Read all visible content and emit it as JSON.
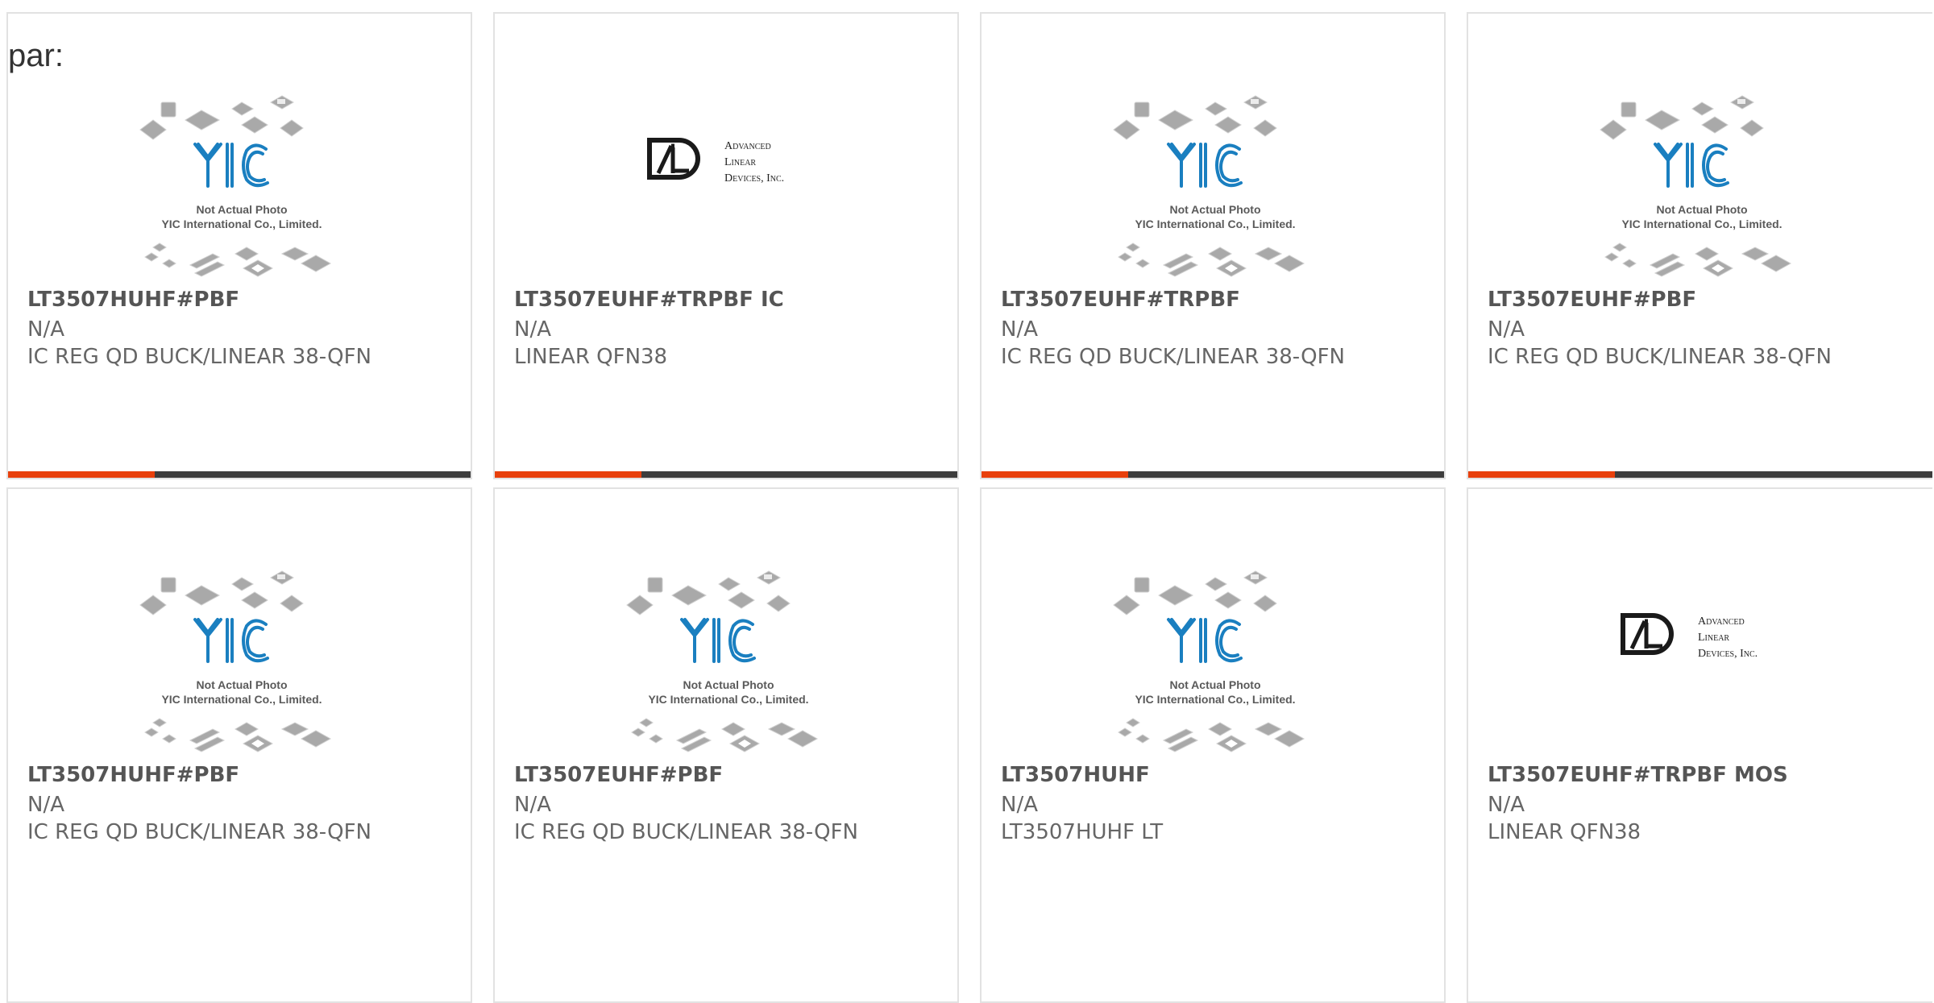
{
  "header": {
    "label": "par:"
  },
  "colors": {
    "accent": "#e8400c",
    "bar": "#3d3d3d",
    "logo_blue": "#1a7fc0"
  },
  "image_texts": {
    "yic_line1": "Not Actual Photo",
    "yic_line2": "YIC International Co., Limited.",
    "ald_line1": "Advanced",
    "ald_line2": "Linear",
    "ald_line3": "Devices, Inc."
  },
  "products": [
    {
      "image": "yic-placeholder",
      "part": "LT3507HUHF#PBF",
      "mfr": "N/A",
      "desc": "IC REG QD BUCK/LINEAR 38-QFN"
    },
    {
      "image": "ald-logo",
      "part": "LT3507EUHF#TRPBF IC",
      "mfr": "N/A",
      "desc": "LINEAR QFN38"
    },
    {
      "image": "yic-placeholder",
      "part": "LT3507EUHF#TRPBF",
      "mfr": "N/A",
      "desc": "IC REG QD BUCK/LINEAR 38-QFN"
    },
    {
      "image": "yic-placeholder",
      "part": "LT3507EUHF#PBF",
      "mfr": "N/A",
      "desc": "IC REG QD BUCK/LINEAR 38-QFN"
    },
    {
      "image": "yic-placeholder",
      "part": "LT3507HUHF#PBF",
      "mfr": "N/A",
      "desc": "IC REG QD BUCK/LINEAR 38-QFN"
    },
    {
      "image": "yic-placeholder",
      "part": "LT3507EUHF#PBF",
      "mfr": "N/A",
      "desc": "IC REG QD BUCK/LINEAR 38-QFN"
    },
    {
      "image": "yic-placeholder",
      "part": "LT3507HUHF",
      "mfr": "N/A",
      "desc": "LT3507HUHF LT"
    },
    {
      "image": "ald-logo",
      "part": "LT3507EUHF#TRPBF MOS",
      "mfr": "N/A",
      "desc": "LINEAR QFN38"
    }
  ]
}
